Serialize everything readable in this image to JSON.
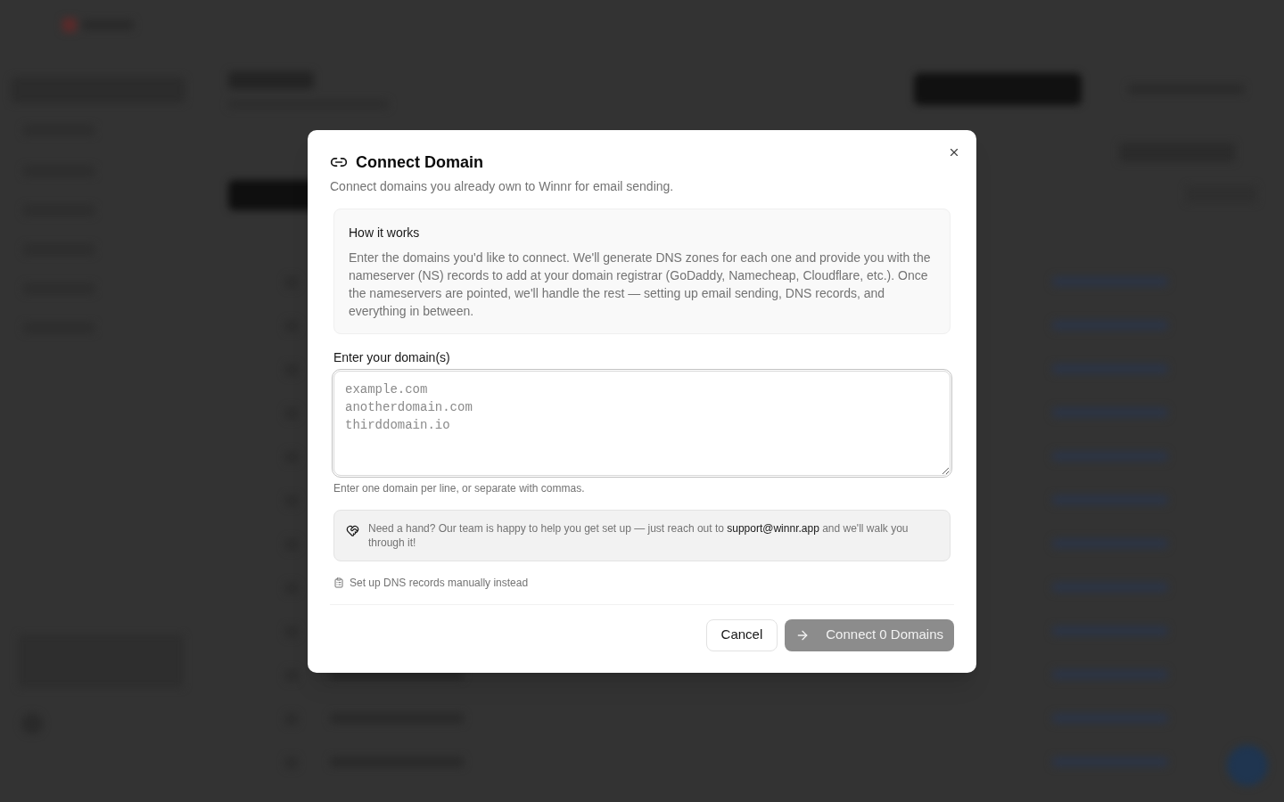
{
  "dialog": {
    "title": "Connect Domain",
    "description": "Connect domains you already own to Winnr for email sending.",
    "info_box": {
      "title": "How it works",
      "body": "Enter the domains you'd like to connect. We'll generate DNS zones for each one and provide you with the nameserver (NS) records to add at your domain registrar (GoDaddy, Namecheap, Cloudflare, etc.). Once the nameservers are pointed, we'll handle the rest — setting up email sending, DNS records, and everything in between."
    },
    "domains_field": {
      "label": "Enter your domain(s)",
      "placeholder": "example.com\nanotherdomain.com\nthirddomain.io",
      "hint": "Enter one domain per line, or separate with commas."
    },
    "help_note": "Need a hand? Our team is happy to help you get set up — just reach out to **support@winnr.app** and we'll walk you through it!",
    "manual_link": "Set up DNS records manually instead",
    "buttons": [
      {
        "label": "Cancel",
        "kind": "secondary",
        "disabled": false
      },
      {
        "label": "Connect 0 Domains",
        "kind": "primary",
        "disabled": true
      }
    ]
  }
}
